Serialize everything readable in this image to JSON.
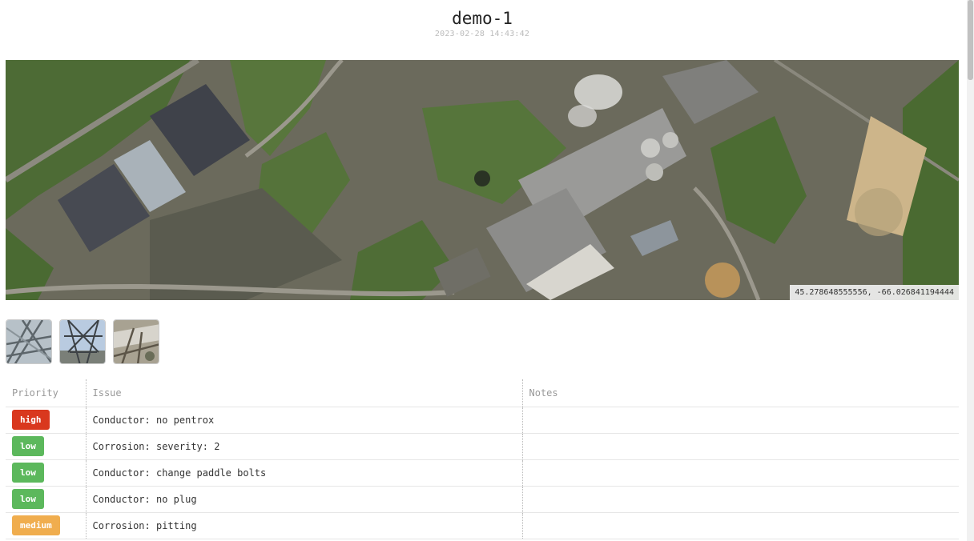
{
  "report": {
    "title": "demo-1",
    "timestamp": "2023-02-28 14:43:42"
  },
  "map": {
    "coordinates": "45.278648555556, -66.026841194444"
  },
  "thumbnails": [
    {
      "icon": "tower-photo-1"
    },
    {
      "icon": "tower-photo-2"
    },
    {
      "icon": "tower-photo-3"
    }
  ],
  "table": {
    "headers": {
      "priority": "Priority",
      "issue": "Issue",
      "notes": "Notes"
    },
    "rows": [
      {
        "priority": "high",
        "issue": "Conductor: no pentrox",
        "notes": ""
      },
      {
        "priority": "low",
        "issue": "Corrosion: severity: 2",
        "notes": ""
      },
      {
        "priority": "low",
        "issue": "Conductor: change paddle bolts",
        "notes": ""
      },
      {
        "priority": "low",
        "issue": "Conductor: no plug",
        "notes": ""
      },
      {
        "priority": "medium",
        "issue": "Corrosion: pitting",
        "notes": ""
      }
    ]
  },
  "colors": {
    "high": "#d9381e",
    "low": "#5cb85c",
    "medium": "#f0ad4e"
  }
}
